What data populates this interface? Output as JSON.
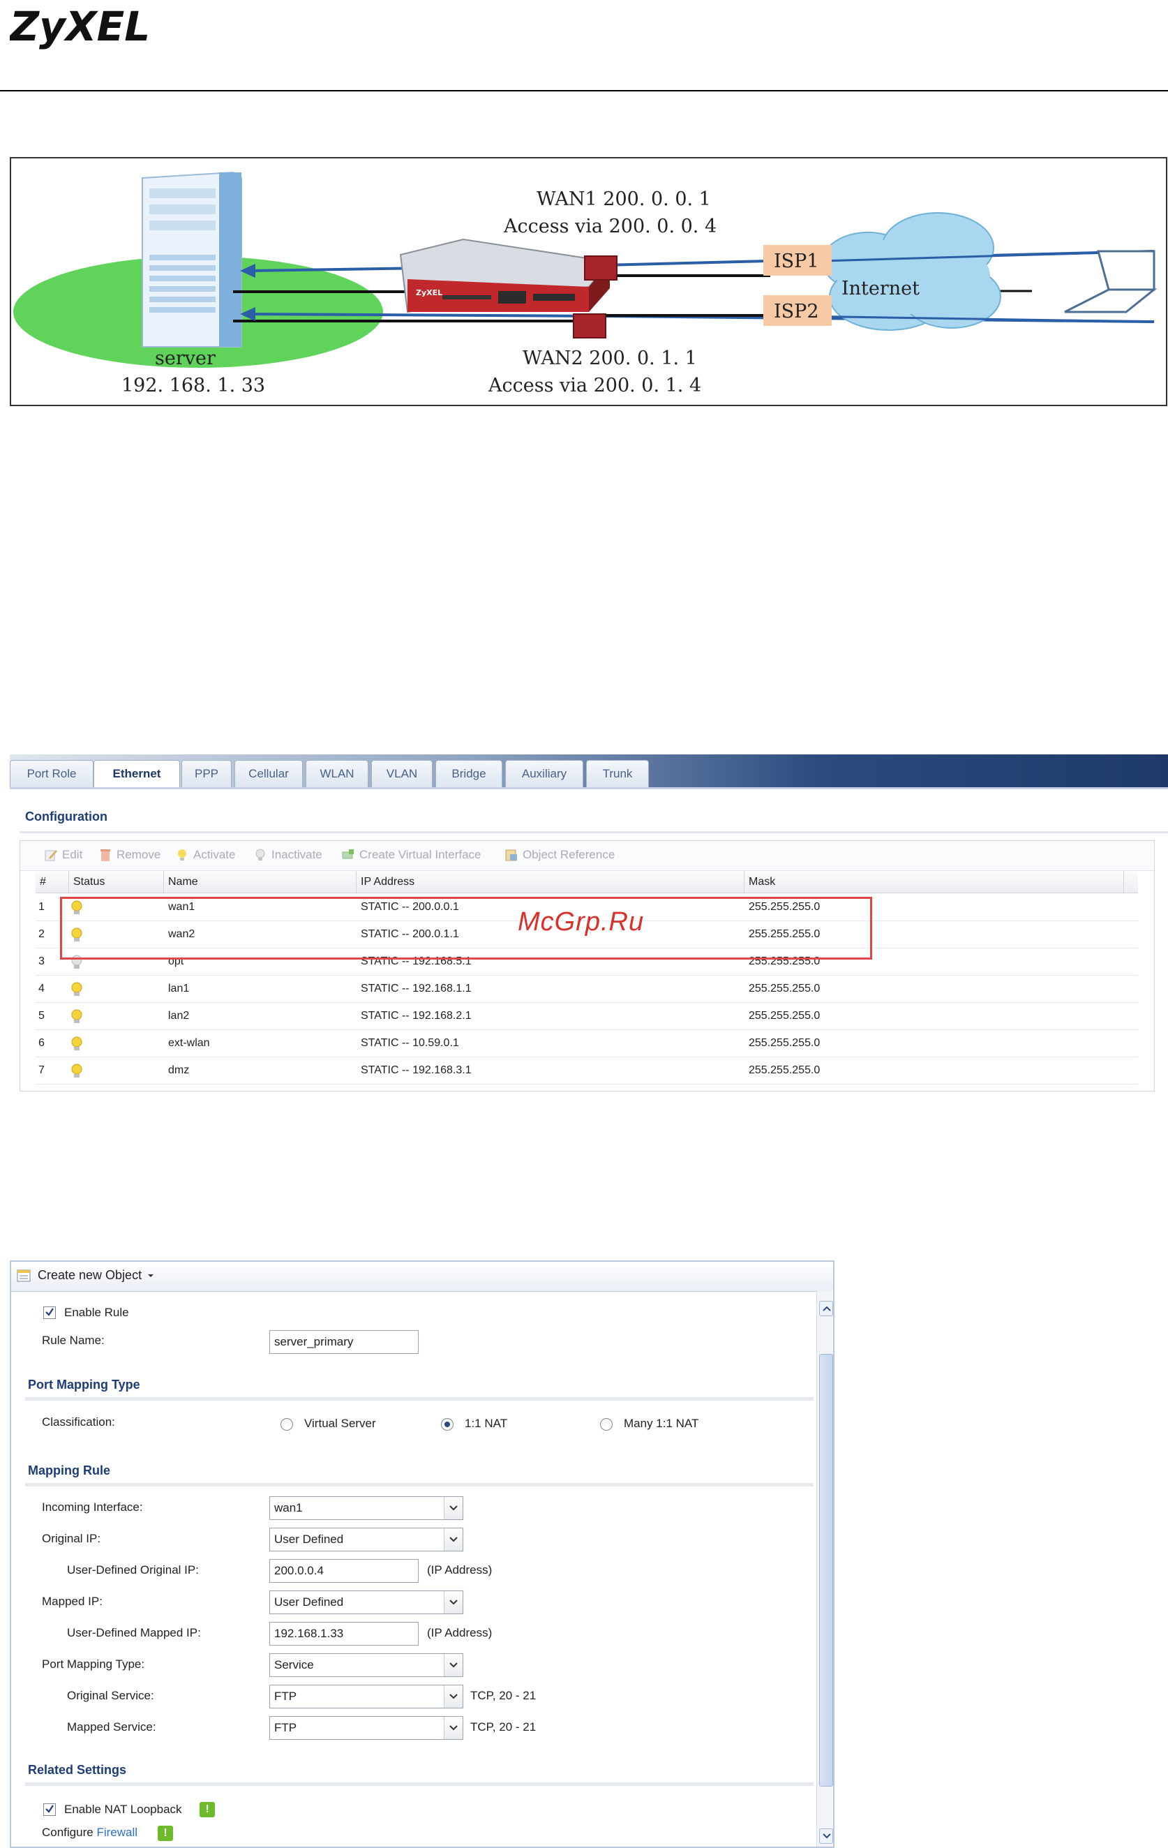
{
  "header": {
    "logo_text": "ZyXEL"
  },
  "diagram": {
    "wan1_label": "WAN1  200. 0. 0. 1",
    "wan1_access": "Access via 200. 0. 0. 4",
    "wan2_label": "WAN2  200. 0. 1. 1",
    "wan2_access": "Access via 200. 0. 1. 4",
    "server_label": "server",
    "server_ip": "192. 168. 1. 33",
    "isp1": "ISP1",
    "isp2": "ISP2",
    "internet": "Internet",
    "device_brand": "ZyXEL",
    "colors": {
      "arrow": "#2a5fa8",
      "isp_box": "#f8c9a5",
      "red_port": "#a8262b",
      "lawn": "#5fd35a",
      "cloud": "#a9d7f0"
    }
  },
  "ethernet": {
    "tabs": [
      "Port Role",
      "Ethernet",
      "PPP",
      "Cellular",
      "WLAN",
      "VLAN",
      "Bridge",
      "Auxiliary",
      "Trunk"
    ],
    "active_tab": "Ethernet",
    "section_title": "Configuration",
    "toolbar": {
      "edit": "Edit",
      "remove": "Remove",
      "activate": "Activate",
      "inactivate": "Inactivate",
      "create_virtual": "Create Virtual Interface",
      "object_reference": "Object Reference"
    },
    "columns": [
      "#",
      "Status",
      "Name",
      "IP Address",
      "Mask"
    ],
    "rows": [
      {
        "num": "1",
        "status": "active",
        "name": "wan1",
        "ip": "STATIC -- 200.0.0.1",
        "mask": "255.255.255.0"
      },
      {
        "num": "2",
        "status": "active",
        "name": "wan2",
        "ip": "STATIC -- 200.0.1.1",
        "mask": "255.255.255.0"
      },
      {
        "num": "3",
        "status": "inactive",
        "name": "opt",
        "ip": "STATIC -- 192.168.5.1",
        "mask": "255.255.255.0"
      },
      {
        "num": "4",
        "status": "active",
        "name": "lan1",
        "ip": "STATIC -- 192.168.1.1",
        "mask": "255.255.255.0"
      },
      {
        "num": "5",
        "status": "active",
        "name": "lan2",
        "ip": "STATIC -- 192.168.2.1",
        "mask": "255.255.255.0"
      },
      {
        "num": "6",
        "status": "active",
        "name": "ext-wlan",
        "ip": "STATIC -- 10.59.0.1",
        "mask": "255.255.255.0"
      },
      {
        "num": "7",
        "status": "active",
        "name": "dmz",
        "ip": "STATIC -- 192.168.3.1",
        "mask": "255.255.255.0"
      }
    ],
    "watermark": "McGrp.Ru"
  },
  "nat": {
    "create_new_object": "Create new Object",
    "enable_rule": "Enable Rule",
    "rule_name_label": "Rule Name:",
    "rule_name_value": "server_primary",
    "port_mapping_type_title": "Port Mapping Type",
    "classification_label": "Classification:",
    "options": {
      "virtual_server": "Virtual Server",
      "one_to_one": "1:1 NAT",
      "many_one_to_one": "Many 1:1 NAT"
    },
    "selected_option": "1:1 NAT",
    "mapping_rule_title": "Mapping Rule",
    "incoming_interface_label": "Incoming Interface:",
    "incoming_interface_value": "wan1",
    "original_ip_label": "Original IP:",
    "original_ip_value": "User Defined",
    "user_defined_original_ip_label": "User-Defined Original IP:",
    "user_defined_original_ip_value": "200.0.0.4",
    "mapped_ip_label": "Mapped IP:",
    "mapped_ip_value": "User Defined",
    "user_defined_mapped_ip_label": "User-Defined Mapped IP:",
    "user_defined_mapped_ip_value": "192.168.1.33",
    "ip_address_hint": "(IP Address)",
    "port_mapping_type_label": "Port Mapping Type:",
    "port_mapping_type_value": "Service",
    "original_service_label": "Original Service:",
    "original_service_value": "FTP",
    "mapped_service_label": "Mapped Service:",
    "mapped_service_value": "FTP",
    "service_hint": "TCP, 20 - 21",
    "related_settings_title": "Related Settings",
    "enable_nat_loopback": "Enable NAT Loopback",
    "configure_label": "Configure",
    "firewall_link": "Firewall",
    "badge_glyph": "!"
  }
}
